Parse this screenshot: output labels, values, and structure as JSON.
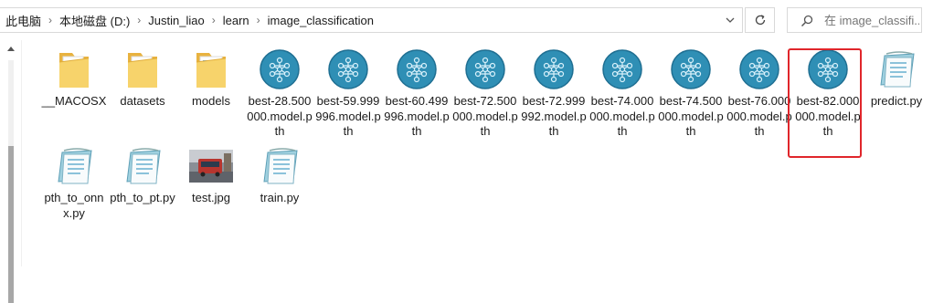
{
  "address_bar": {
    "breadcrumbs": [
      "此电脑",
      "本地磁盘 (D:)",
      "Justin_liao",
      "learn",
      "image_classification"
    ]
  },
  "search": {
    "placeholder": "在 image_classifi..."
  },
  "files": [
    {
      "name": "__MACOSX",
      "icon": "folder-icon"
    },
    {
      "name": "datasets",
      "icon": "folder-icon"
    },
    {
      "name": "models",
      "icon": "folder-icon"
    },
    {
      "name": "best-28.500000.model.pth",
      "icon": "pytorch-model-icon"
    },
    {
      "name": "best-59.999996.model.pth",
      "icon": "pytorch-model-icon"
    },
    {
      "name": "best-60.499996.model.pth",
      "icon": "pytorch-model-icon"
    },
    {
      "name": "best-72.500000.model.pth",
      "icon": "pytorch-model-icon"
    },
    {
      "name": "best-72.999992.model.pth",
      "icon": "pytorch-model-icon"
    },
    {
      "name": "best-74.000000.model.pth",
      "icon": "pytorch-model-icon"
    },
    {
      "name": "best-74.500000.model.pth",
      "icon": "pytorch-model-icon"
    },
    {
      "name": "best-76.000000.model.pth",
      "icon": "pytorch-model-icon"
    },
    {
      "name": "best-82.000000.model.pth",
      "icon": "pytorch-model-icon",
      "highlighted": true
    },
    {
      "name": "predict.py",
      "icon": "python-script-icon"
    },
    {
      "name": "pth_to_onnx.py",
      "icon": "python-script-icon"
    },
    {
      "name": "pth_to_pt.py",
      "icon": "python-script-icon"
    },
    {
      "name": "test.jpg",
      "icon": "image-thumbnail-icon"
    },
    {
      "name": "train.py",
      "icon": "python-script-icon"
    }
  ],
  "colors": {
    "highlight_border": "#e0262b",
    "model_icon": "#2f8fb5",
    "folder": "#f2c55c"
  }
}
